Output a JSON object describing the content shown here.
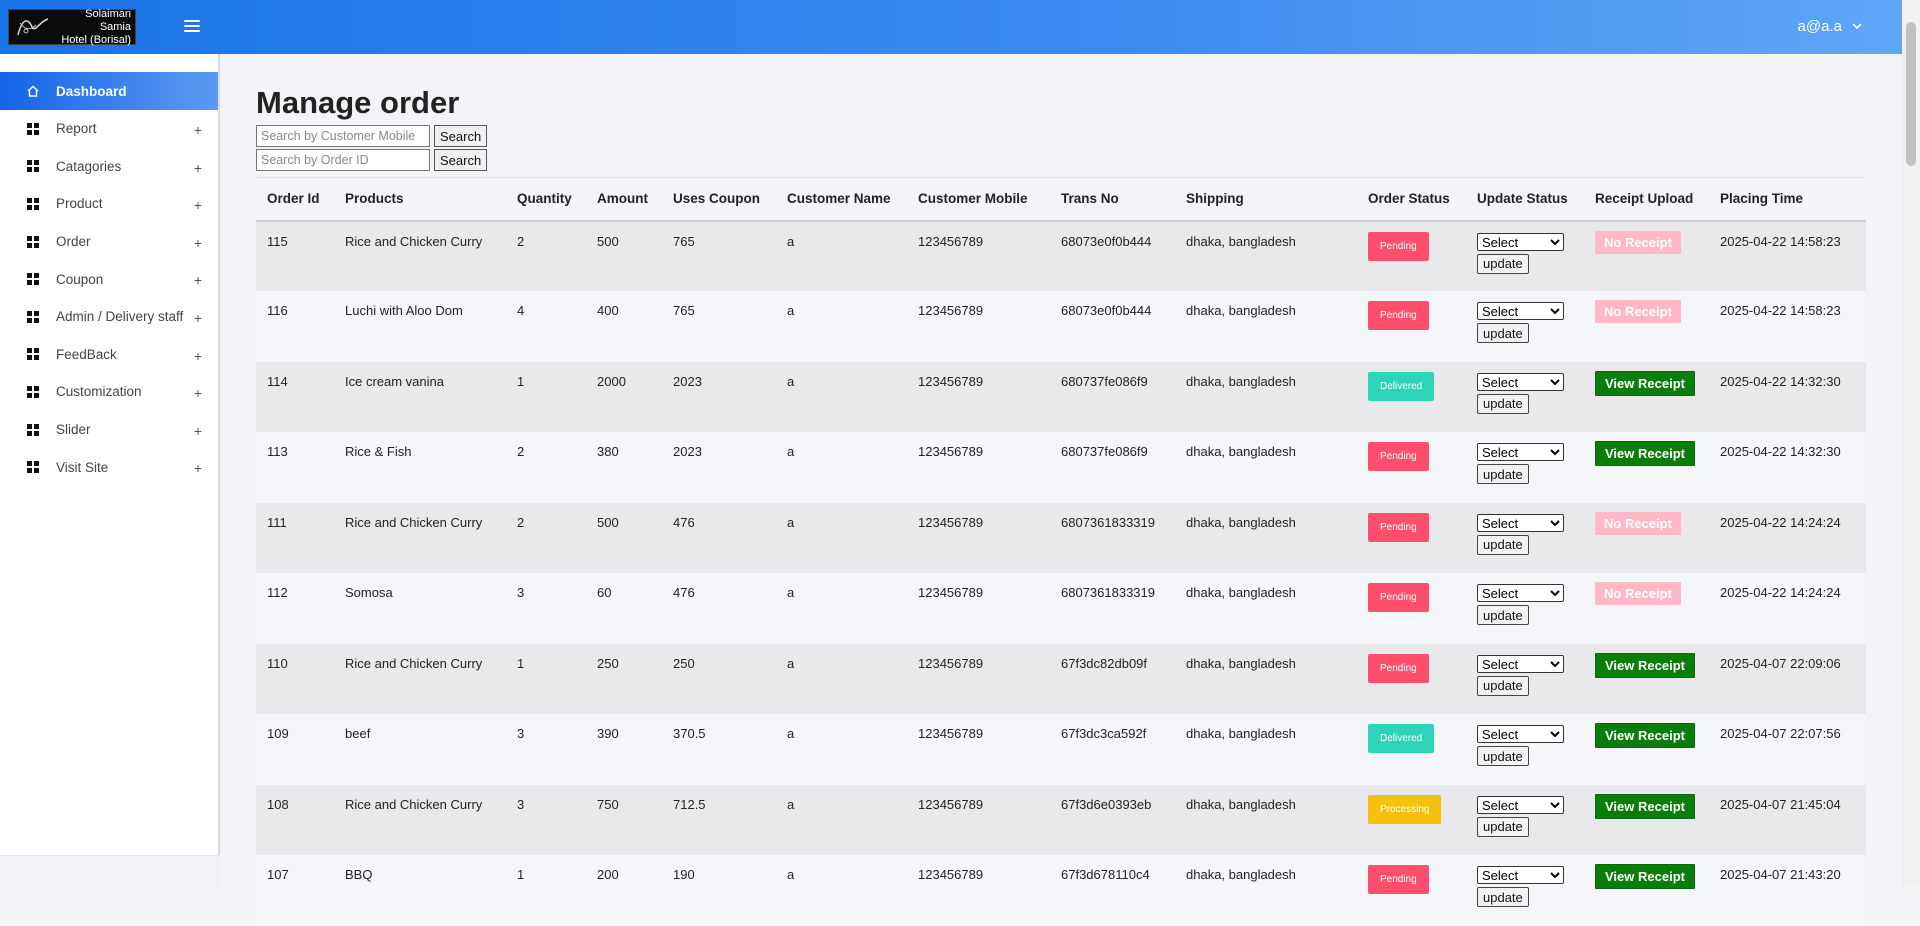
{
  "header": {
    "logo_line1": "Solaiman Samia",
    "logo_line2": "Hotel (Borisal)",
    "user": "a@a.a"
  },
  "sidebar": {
    "items": [
      {
        "label": "Dashboard",
        "active": true
      },
      {
        "label": "Report"
      },
      {
        "label": "Catagories"
      },
      {
        "label": "Product"
      },
      {
        "label": "Order"
      },
      {
        "label": "Coupon"
      },
      {
        "label": "Admin / Delivery staff"
      },
      {
        "label": "FeedBack"
      },
      {
        "label": "Customization"
      },
      {
        "label": "Slider"
      },
      {
        "label": "Visit Site"
      }
    ],
    "plus": "+"
  },
  "page": {
    "title": "Manage order",
    "search_mobile_placeholder": "Search by Customer Mobile",
    "search_order_placeholder": "Search by Order ID",
    "search_label": "Search"
  },
  "table": {
    "columns": [
      "Order Id",
      "Products",
      "Quantity",
      "Amount",
      "Uses Coupon",
      "Customer Name",
      "Customer Mobile",
      "Trans No",
      "Shipping",
      "Order Status",
      "Update Status",
      "Receipt Upload",
      "Placing Time"
    ],
    "select_label": "Select",
    "update_label": "update",
    "rows": [
      {
        "id": "115",
        "product": "Rice and Chicken Curry",
        "qty": "2",
        "amount": "500",
        "coupon": "765",
        "name": "a",
        "mobile": "123456789",
        "trans": "68073e0f0b444",
        "shipping": "dhaka, bangladesh",
        "status": "Pending",
        "receipt": "No Receipt",
        "time": "2025-04-22 14:58:23"
      },
      {
        "id": "116",
        "product": "Luchi with Aloo Dom",
        "qty": "4",
        "amount": "400",
        "coupon": "765",
        "name": "a",
        "mobile": "123456789",
        "trans": "68073e0f0b444",
        "shipping": "dhaka, bangladesh",
        "status": "Pending",
        "receipt": "No Receipt",
        "time": "2025-04-22 14:58:23"
      },
      {
        "id": "114",
        "product": "Ice cream vanina",
        "qty": "1",
        "amount": "2000",
        "coupon": "2023",
        "name": "a",
        "mobile": "123456789",
        "trans": "680737fe086f9",
        "shipping": "dhaka, bangladesh",
        "status": "Delivered",
        "receipt": "View Receipt",
        "time": "2025-04-22 14:32:30"
      },
      {
        "id": "113",
        "product": "Rice & Fish",
        "qty": "2",
        "amount": "380",
        "coupon": "2023",
        "name": "a",
        "mobile": "123456789",
        "trans": "680737fe086f9",
        "shipping": "dhaka, bangladesh",
        "status": "Pending",
        "receipt": "View Receipt",
        "time": "2025-04-22 14:32:30"
      },
      {
        "id": "111",
        "product": "Rice and Chicken Curry",
        "qty": "2",
        "amount": "500",
        "coupon": "476",
        "name": "a",
        "mobile": "123456789",
        "trans": "6807361833319",
        "shipping": "dhaka, bangladesh",
        "status": "Pending",
        "receipt": "No Receipt",
        "time": "2025-04-22 14:24:24"
      },
      {
        "id": "112",
        "product": "Somosa",
        "qty": "3",
        "amount": "60",
        "coupon": "476",
        "name": "a",
        "mobile": "123456789",
        "trans": "6807361833319",
        "shipping": "dhaka, bangladesh",
        "status": "Pending",
        "receipt": "No Receipt",
        "time": "2025-04-22 14:24:24"
      },
      {
        "id": "110",
        "product": "Rice and Chicken Curry",
        "qty": "1",
        "amount": "250",
        "coupon": "250",
        "name": "a",
        "mobile": "123456789",
        "trans": "67f3dc82db09f",
        "shipping": "dhaka, bangladesh",
        "status": "Pending",
        "receipt": "View Receipt",
        "time": "2025-04-07 22:09:06"
      },
      {
        "id": "109",
        "product": "beef",
        "qty": "3",
        "amount": "390",
        "coupon": "370.5",
        "name": "a",
        "mobile": "123456789",
        "trans": "67f3dc3ca592f",
        "shipping": "dhaka, bangladesh",
        "status": "Delivered",
        "receipt": "View Receipt",
        "time": "2025-04-07 22:07:56"
      },
      {
        "id": "108",
        "product": "Rice and Chicken Curry",
        "qty": "3",
        "amount": "750",
        "coupon": "712.5",
        "name": "a",
        "mobile": "123456789",
        "trans": "67f3d6e0393eb",
        "shipping": "dhaka, bangladesh",
        "status": "Processing",
        "receipt": "View Receipt",
        "time": "2025-04-07 21:45:04"
      },
      {
        "id": "107",
        "product": "BBQ",
        "qty": "1",
        "amount": "200",
        "coupon": "190",
        "name": "a",
        "mobile": "123456789",
        "trans": "67f3d678110c4",
        "shipping": "dhaka, bangladesh",
        "status": "Pending",
        "receipt": "View Receipt",
        "time": "2025-04-07 21:43:20"
      }
    ]
  },
  "colors": {
    "pending": "#ff4f6d",
    "delivered": "#2dd4b8",
    "processing": "#f4c20d",
    "view_receipt": "#0b7d0b",
    "no_receipt": "#ffb9c6",
    "accent": "#1a73e8"
  }
}
